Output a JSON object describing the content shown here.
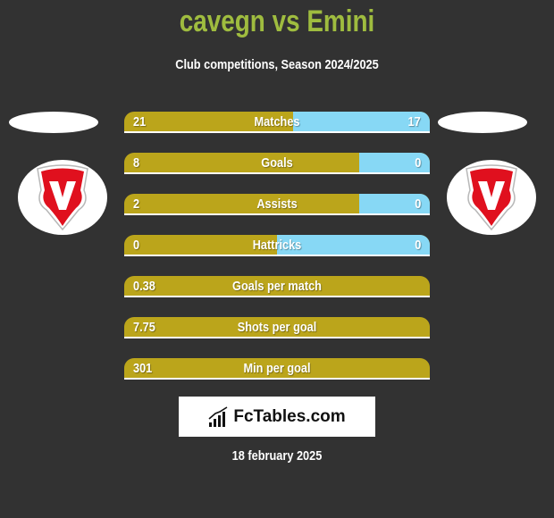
{
  "header": {
    "title": "cavegn vs Emini",
    "subtitle": "Club competitions, Season 2024/2025"
  },
  "players": {
    "left": {
      "name": "cavegn",
      "badge_icon": "club-crest-v-shield-icon"
    },
    "right": {
      "name": "Emini",
      "badge_icon": "club-crest-v-shield-icon"
    }
  },
  "colors": {
    "background": "#323232",
    "title": "#9fbc3f",
    "left_bar": "#bba51b",
    "right_bar": "#87d8f5",
    "crest_red": "#e0101e"
  },
  "stats": [
    {
      "label": "Matches",
      "left": "21",
      "right": "17",
      "left_share": 0.553
    },
    {
      "label": "Goals",
      "left": "8",
      "right": "0",
      "left_share": 0.77
    },
    {
      "label": "Assists",
      "left": "2",
      "right": "0",
      "left_share": 0.77
    },
    {
      "label": "Hattricks",
      "left": "0",
      "right": "0",
      "left_share": 0.5
    },
    {
      "label": "Goals per match",
      "left": "0.38",
      "right": "",
      "left_share": 1.0
    },
    {
      "label": "Shots per goal",
      "left": "7.75",
      "right": "",
      "left_share": 1.0
    },
    {
      "label": "Min per goal",
      "left": "301",
      "right": "",
      "left_share": 1.0
    }
  ],
  "footer": {
    "logo_text": "FcTables.com",
    "logo_icon": "bar-chart-trend-icon",
    "date": "18 february 2025"
  }
}
